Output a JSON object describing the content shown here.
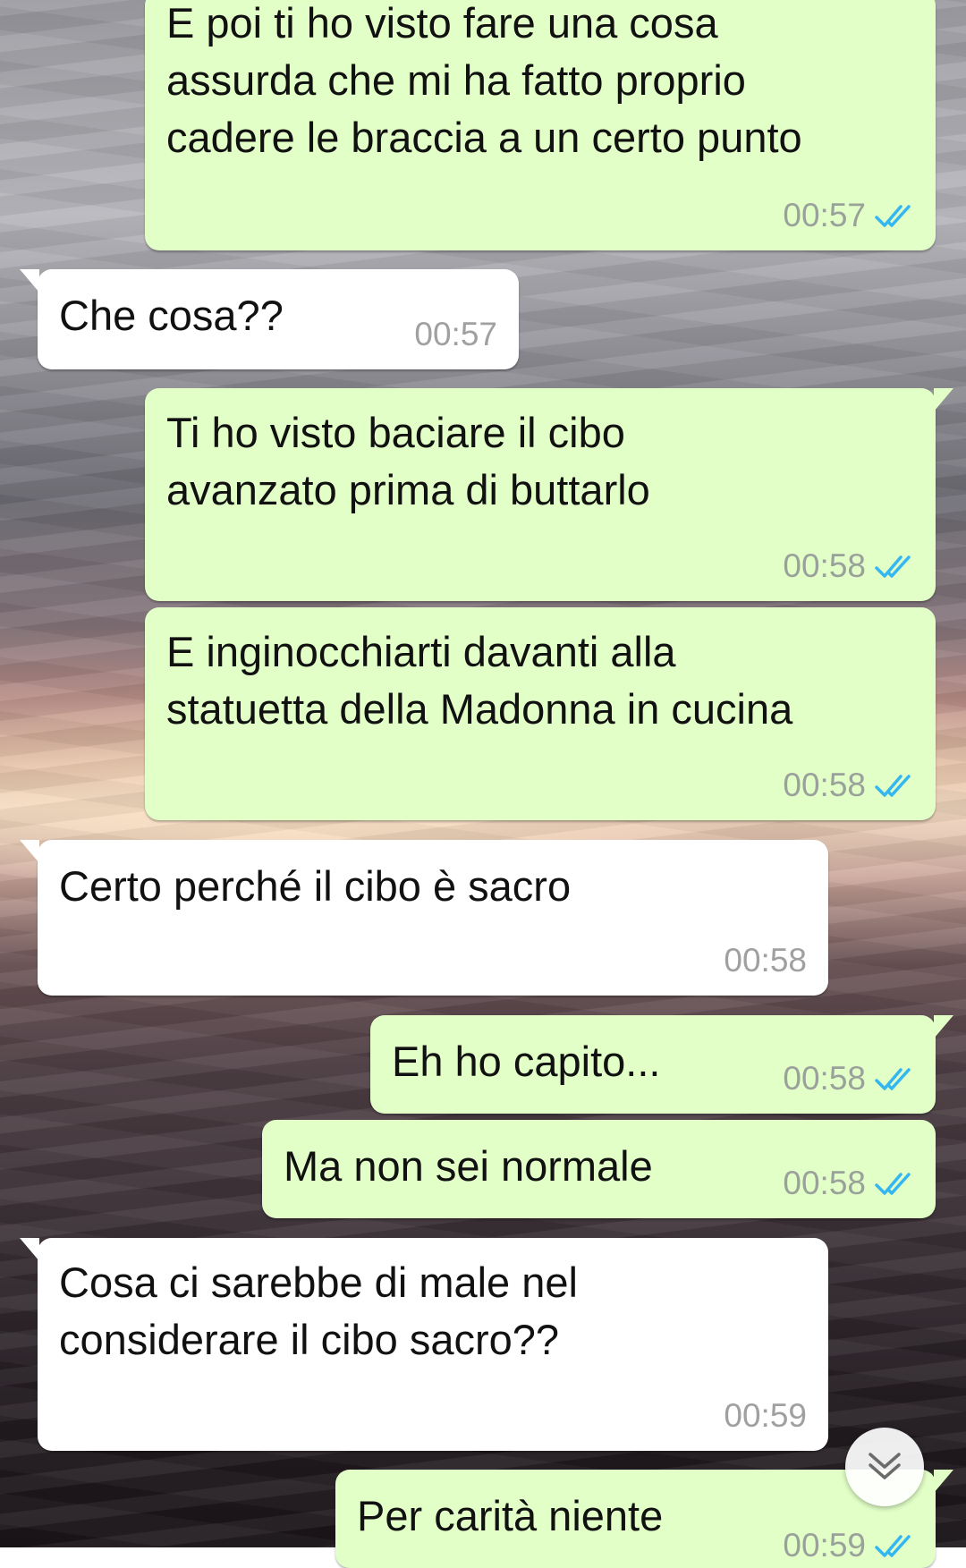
{
  "messages": [
    {
      "direction": "out",
      "text": "E poi ti ho visto fare una cosa\nassurda che mi ha fatto proprio\ncadere le braccia a un certo punto",
      "time": "00:57",
      "status": "read"
    },
    {
      "direction": "in",
      "text": "Che cosa??",
      "time": "00:57"
    },
    {
      "direction": "out",
      "text": "Ti ho visto baciare il cibo\navanzato prima di buttarlo",
      "time": "00:58",
      "status": "read"
    },
    {
      "direction": "out",
      "text": "E inginocchiarti davanti alla\nstatuetta della Madonna in cucina",
      "time": "00:58",
      "status": "read"
    },
    {
      "direction": "in",
      "text": "Certo perché il cibo è sacro",
      "time": "00:58"
    },
    {
      "direction": "out",
      "text": "Eh ho capito...",
      "time": "00:58",
      "status": "read"
    },
    {
      "direction": "out",
      "text": "Ma non sei normale",
      "time": "00:58",
      "status": "read"
    },
    {
      "direction": "in",
      "text": "Cosa ci sarebbe di male nel\nconsiderare il cibo sacro??",
      "time": "00:59"
    },
    {
      "direction": "out",
      "text": "Per carità niente",
      "time": "00:59",
      "status": "read"
    }
  ],
  "colors": {
    "outgoing_bubble": "#e2ffc7",
    "incoming_bubble": "#ffffff",
    "read_ticks": "#34b7f1"
  },
  "icons": {
    "read_receipt": "double-check-icon",
    "scroll_down": "chevron-double-down-icon"
  }
}
